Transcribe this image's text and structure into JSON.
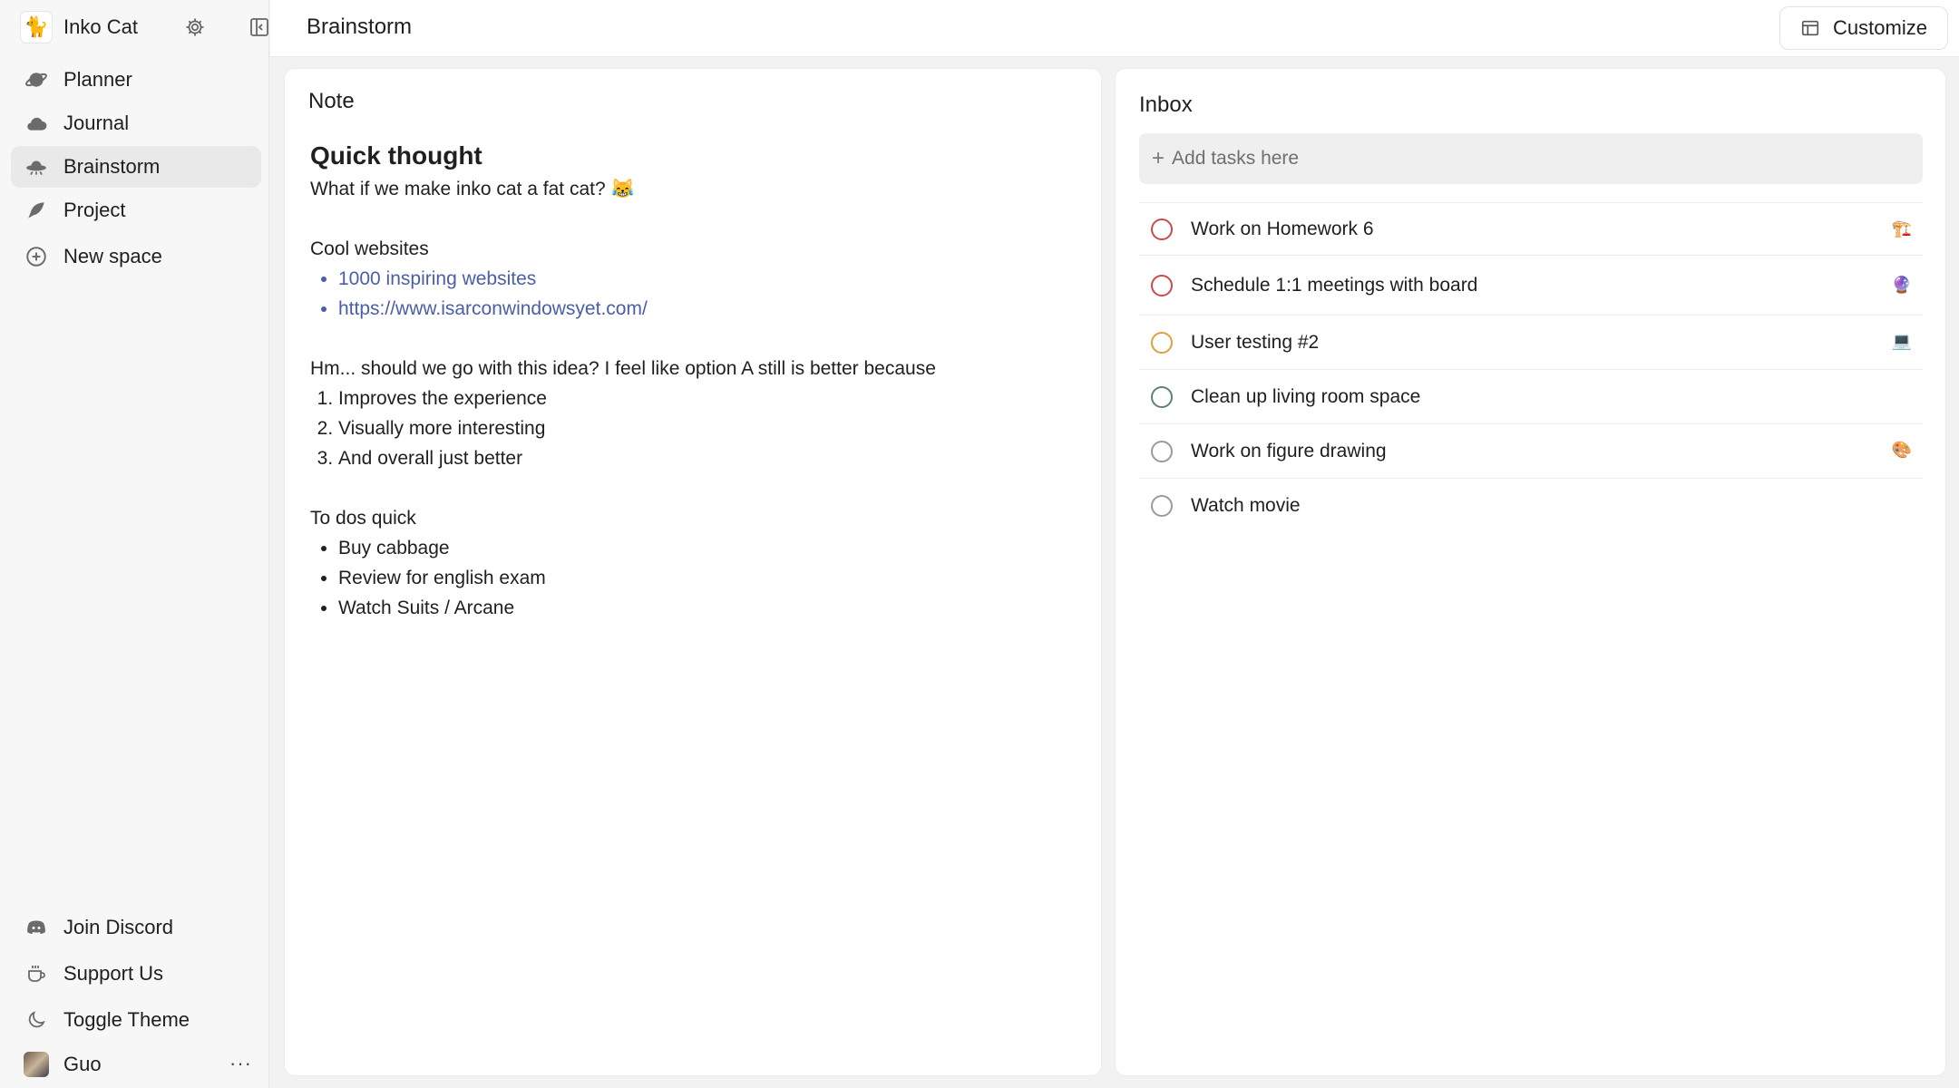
{
  "sidebar": {
    "app_name": "Inko Cat",
    "items": [
      {
        "label": "Planner",
        "icon": "planet-icon"
      },
      {
        "label": "Journal",
        "icon": "cloud-icon"
      },
      {
        "label": "Brainstorm",
        "icon": "ufo-icon",
        "active": true
      },
      {
        "label": "Project",
        "icon": "bird-icon"
      },
      {
        "label": "New space",
        "icon": "plus-circle-icon"
      }
    ],
    "bottom": [
      {
        "label": "Join Discord",
        "icon": "discord-icon"
      },
      {
        "label": "Support Us",
        "icon": "coffee-icon"
      },
      {
        "label": "Toggle Theme",
        "icon": "moon-icon"
      }
    ],
    "user": {
      "name": "Guo",
      "more": "···"
    }
  },
  "header": {
    "title": "Brainstorm",
    "customize_label": "Customize"
  },
  "note": {
    "title": "Note",
    "heading": "Quick thought",
    "line1": "What if we make inko cat a fat cat? 😹",
    "section1": "Cool websites",
    "links": [
      "1000 inspiring websites",
      "https://www.isarconwindowsyet.com/"
    ],
    "question": "Hm... should we go with this idea? I feel like option A still is better because",
    "reasons": [
      "Improves the experience",
      "Visually more interesting",
      "And overall just better"
    ],
    "section2": "To dos quick",
    "todos": [
      "Buy cabbage",
      "Review for english exam",
      "Watch Suits / Arcane"
    ]
  },
  "inbox": {
    "title": "Inbox",
    "add_placeholder": "Add tasks here",
    "tasks": [
      {
        "label": "Work on Homework 6",
        "color": "#c94a4a",
        "emoji": "🏗️"
      },
      {
        "label": "Schedule 1:1 meetings with board",
        "color": "#c94a4a",
        "emoji": "🔮"
      },
      {
        "label": "User testing #2",
        "color": "#e0a040",
        "emoji": "💻"
      },
      {
        "label": "Clean up living room space",
        "color": "#5f7f7a",
        "emoji": ""
      },
      {
        "label": "Work on figure drawing",
        "color": "#9a9a9a",
        "emoji": "🎨"
      },
      {
        "label": "Watch movie",
        "color": "#9a9a9a",
        "emoji": ""
      }
    ]
  }
}
